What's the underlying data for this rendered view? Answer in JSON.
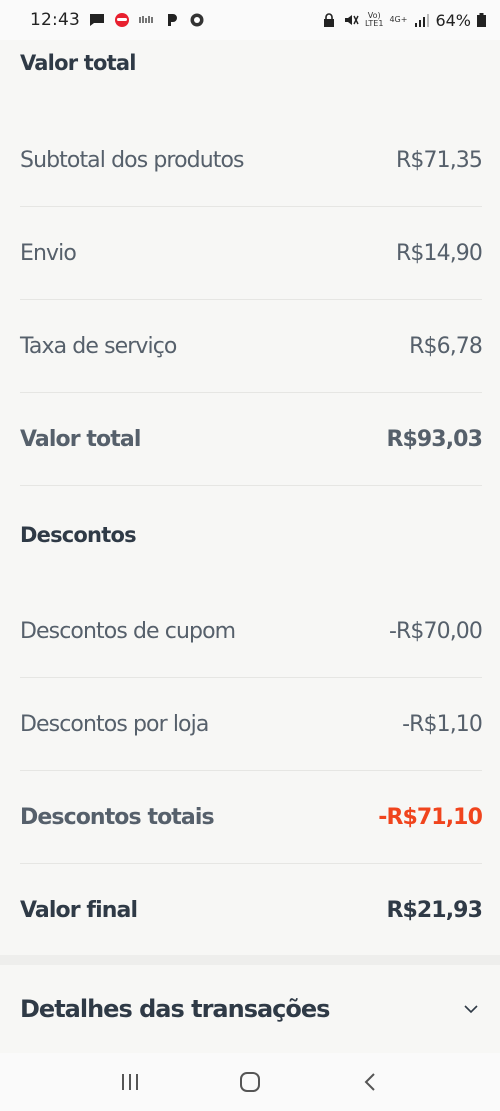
{
  "status_bar": {
    "time": "12:43",
    "network_text_top": "Vo)",
    "network_text_bottom": "LTE1",
    "data_text": "4G+",
    "battery": "64%"
  },
  "summary": {
    "section_title": "Valor total",
    "rows": [
      {
        "label": "Subtotal dos produtos",
        "value": "R$71,35"
      },
      {
        "label": "Envio",
        "value": "R$14,90"
      },
      {
        "label": "Taxa de serviço",
        "value": "R$6,78"
      },
      {
        "label": "Valor total",
        "value": "R$93,03"
      }
    ]
  },
  "discounts": {
    "section_title": "Descontos",
    "rows": [
      {
        "label": "Descontos de cupom",
        "value": "-R$70,00"
      },
      {
        "label": "Descontos por loja",
        "value": "-R$1,10"
      },
      {
        "label": "Descontos totais",
        "value": "-R$71,10"
      }
    ]
  },
  "final": {
    "label": "Valor final",
    "value": "R$21,93"
  },
  "details": {
    "title": "Detalhes das transações"
  },
  "colors": {
    "accent": "#f0441d",
    "text_dark": "#2f3a46",
    "text_muted": "#56606b"
  }
}
